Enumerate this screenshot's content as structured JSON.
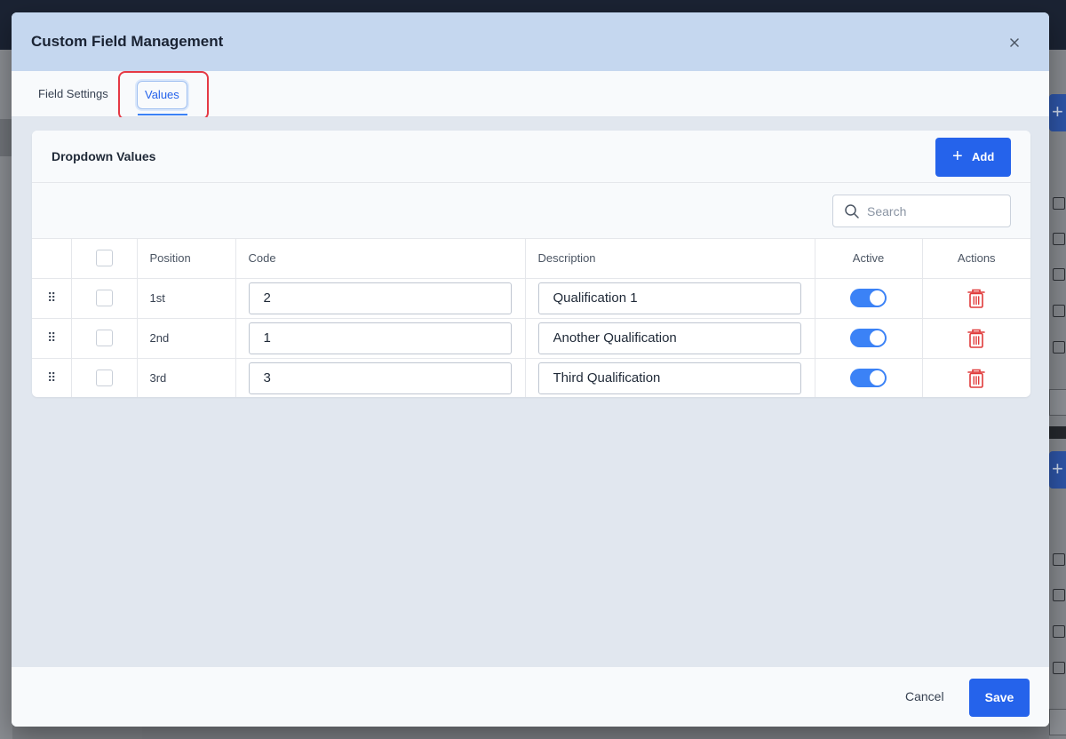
{
  "modal": {
    "title": "Custom Field Management",
    "tabs": [
      {
        "label": "Field Settings",
        "active": false
      },
      {
        "label": "Values",
        "active": true
      }
    ],
    "card": {
      "title": "Dropdown Values",
      "add_label": "Add",
      "search_placeholder": "Search",
      "columns": {
        "position": "Position",
        "code": "Code",
        "description": "Description",
        "active": "Active",
        "actions": "Actions"
      },
      "rows": [
        {
          "position": "1st",
          "code": "2",
          "description": "Qualification 1",
          "active": true
        },
        {
          "position": "2nd",
          "code": "1",
          "description": "Another Qualification",
          "active": true
        },
        {
          "position": "3rd",
          "code": "3",
          "description": "Third Qualification",
          "active": true
        }
      ]
    },
    "footer": {
      "cancel_label": "Cancel",
      "save_label": "Save"
    }
  },
  "colors": {
    "accent": "#2563eb",
    "header_bg": "#c5d7ef",
    "toggle_on": "#3b82f6",
    "danger": "#e03a3a",
    "highlight": "#e53945"
  }
}
